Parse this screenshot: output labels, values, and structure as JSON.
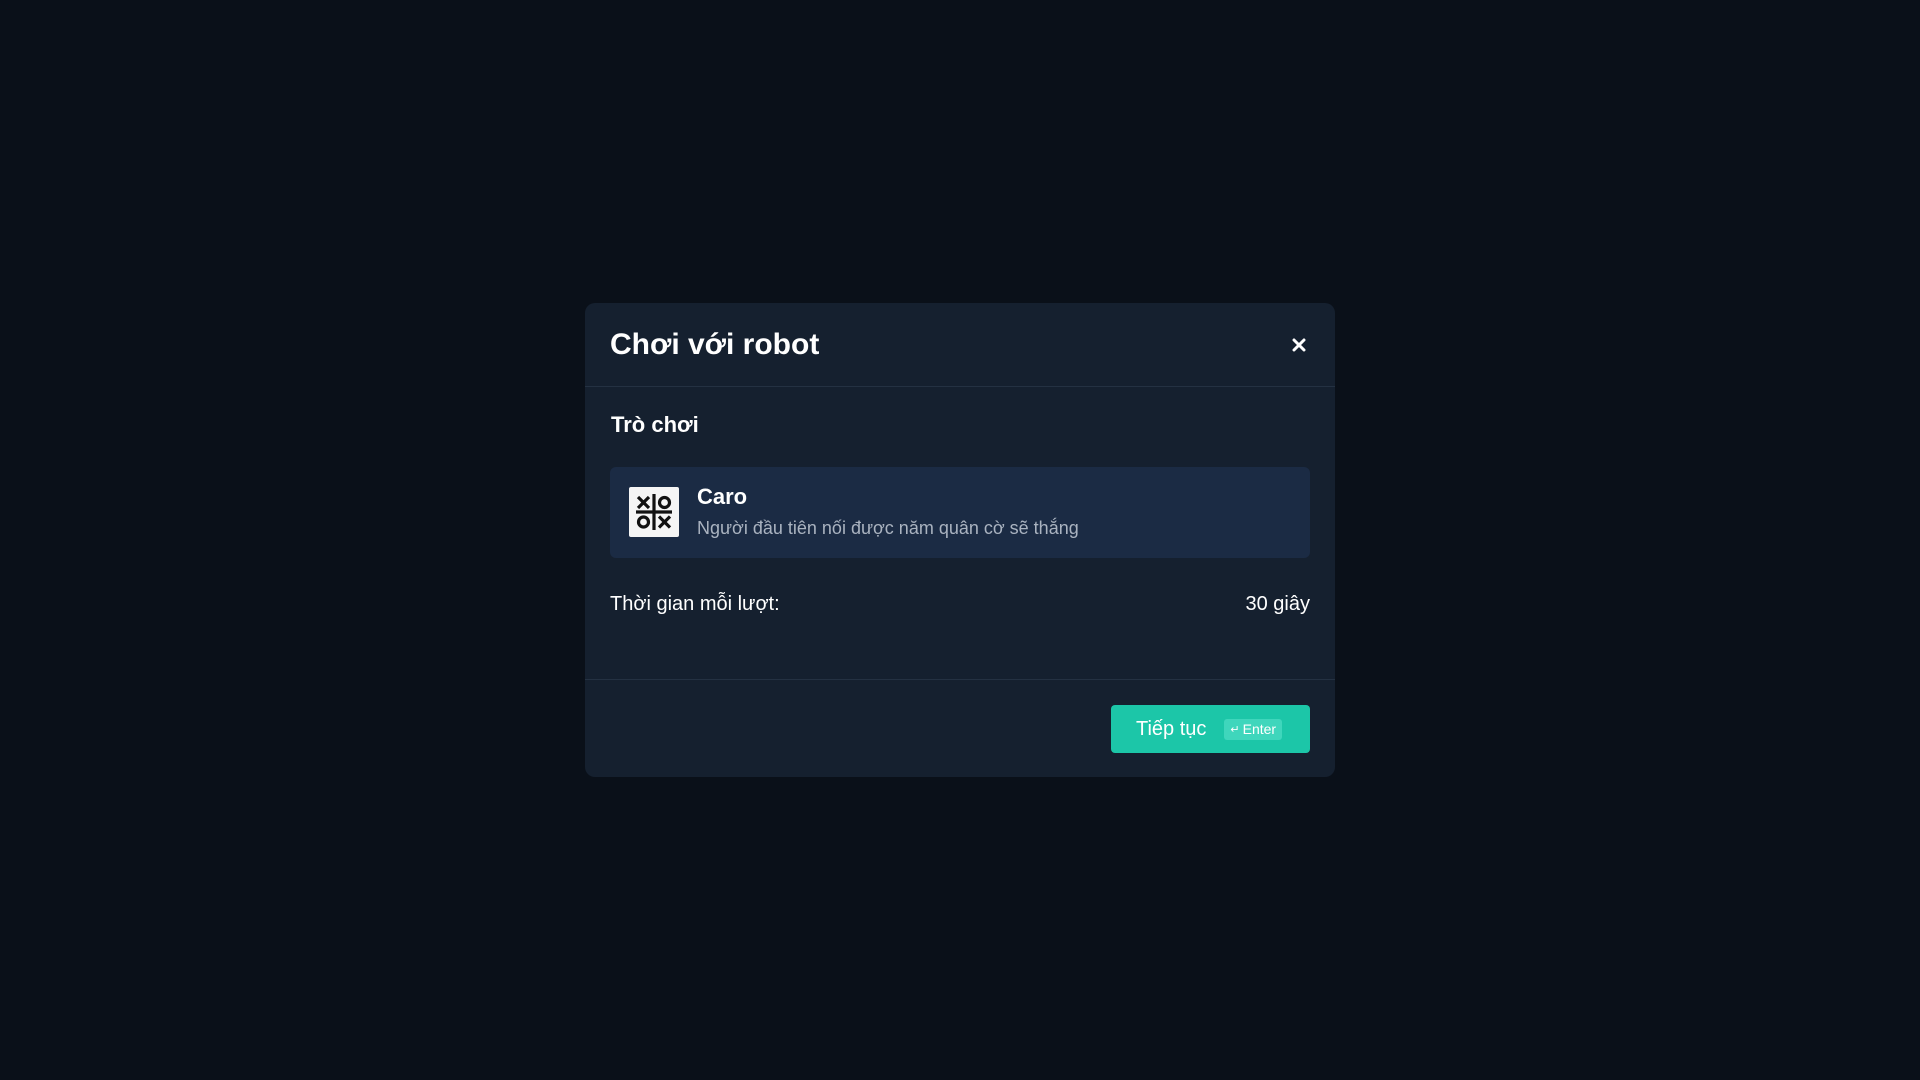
{
  "modal": {
    "title": "Chơi với robot",
    "close_icon": "close-icon"
  },
  "body": {
    "section_title": "Trò chơi",
    "game": {
      "icon": "tic-tac-toe-icon",
      "name": "Caro",
      "description": "Người đầu tiên nối được năm quân cờ sẽ thắng"
    },
    "time_label": "Thời gian mỗi lượt:",
    "time_value": "30 giây"
  },
  "footer": {
    "continue_label": "Tiếp tục",
    "shortcut_label": "Enter",
    "shortcut_icon": "enter-key-icon"
  },
  "colors": {
    "background": "#0a1019",
    "modal": "#15202f",
    "card": "#1b2b44",
    "accent": "#1cc6a8"
  }
}
